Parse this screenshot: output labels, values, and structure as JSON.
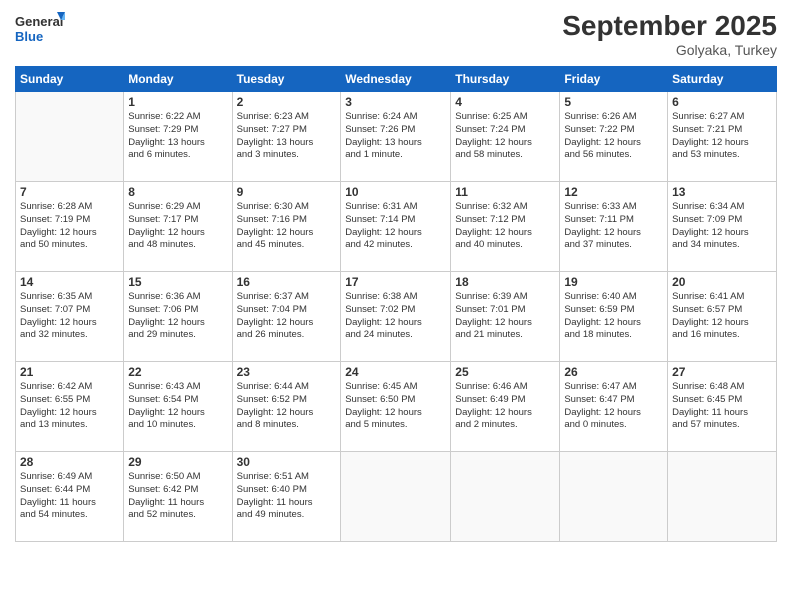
{
  "logo": {
    "line1": "General",
    "line2": "Blue"
  },
  "title": "September 2025",
  "location": "Golyaka, Turkey",
  "days_header": [
    "Sunday",
    "Monday",
    "Tuesday",
    "Wednesday",
    "Thursday",
    "Friday",
    "Saturday"
  ],
  "weeks": [
    [
      {
        "day": "",
        "info": ""
      },
      {
        "day": "1",
        "info": "Sunrise: 6:22 AM\nSunset: 7:29 PM\nDaylight: 13 hours\nand 6 minutes."
      },
      {
        "day": "2",
        "info": "Sunrise: 6:23 AM\nSunset: 7:27 PM\nDaylight: 13 hours\nand 3 minutes."
      },
      {
        "day": "3",
        "info": "Sunrise: 6:24 AM\nSunset: 7:26 PM\nDaylight: 13 hours\nand 1 minute."
      },
      {
        "day": "4",
        "info": "Sunrise: 6:25 AM\nSunset: 7:24 PM\nDaylight: 12 hours\nand 58 minutes."
      },
      {
        "day": "5",
        "info": "Sunrise: 6:26 AM\nSunset: 7:22 PM\nDaylight: 12 hours\nand 56 minutes."
      },
      {
        "day": "6",
        "info": "Sunrise: 6:27 AM\nSunset: 7:21 PM\nDaylight: 12 hours\nand 53 minutes."
      }
    ],
    [
      {
        "day": "7",
        "info": "Sunrise: 6:28 AM\nSunset: 7:19 PM\nDaylight: 12 hours\nand 50 minutes."
      },
      {
        "day": "8",
        "info": "Sunrise: 6:29 AM\nSunset: 7:17 PM\nDaylight: 12 hours\nand 48 minutes."
      },
      {
        "day": "9",
        "info": "Sunrise: 6:30 AM\nSunset: 7:16 PM\nDaylight: 12 hours\nand 45 minutes."
      },
      {
        "day": "10",
        "info": "Sunrise: 6:31 AM\nSunset: 7:14 PM\nDaylight: 12 hours\nand 42 minutes."
      },
      {
        "day": "11",
        "info": "Sunrise: 6:32 AM\nSunset: 7:12 PM\nDaylight: 12 hours\nand 40 minutes."
      },
      {
        "day": "12",
        "info": "Sunrise: 6:33 AM\nSunset: 7:11 PM\nDaylight: 12 hours\nand 37 minutes."
      },
      {
        "day": "13",
        "info": "Sunrise: 6:34 AM\nSunset: 7:09 PM\nDaylight: 12 hours\nand 34 minutes."
      }
    ],
    [
      {
        "day": "14",
        "info": "Sunrise: 6:35 AM\nSunset: 7:07 PM\nDaylight: 12 hours\nand 32 minutes."
      },
      {
        "day": "15",
        "info": "Sunrise: 6:36 AM\nSunset: 7:06 PM\nDaylight: 12 hours\nand 29 minutes."
      },
      {
        "day": "16",
        "info": "Sunrise: 6:37 AM\nSunset: 7:04 PM\nDaylight: 12 hours\nand 26 minutes."
      },
      {
        "day": "17",
        "info": "Sunrise: 6:38 AM\nSunset: 7:02 PM\nDaylight: 12 hours\nand 24 minutes."
      },
      {
        "day": "18",
        "info": "Sunrise: 6:39 AM\nSunset: 7:01 PM\nDaylight: 12 hours\nand 21 minutes."
      },
      {
        "day": "19",
        "info": "Sunrise: 6:40 AM\nSunset: 6:59 PM\nDaylight: 12 hours\nand 18 minutes."
      },
      {
        "day": "20",
        "info": "Sunrise: 6:41 AM\nSunset: 6:57 PM\nDaylight: 12 hours\nand 16 minutes."
      }
    ],
    [
      {
        "day": "21",
        "info": "Sunrise: 6:42 AM\nSunset: 6:55 PM\nDaylight: 12 hours\nand 13 minutes."
      },
      {
        "day": "22",
        "info": "Sunrise: 6:43 AM\nSunset: 6:54 PM\nDaylight: 12 hours\nand 10 minutes."
      },
      {
        "day": "23",
        "info": "Sunrise: 6:44 AM\nSunset: 6:52 PM\nDaylight: 12 hours\nand 8 minutes."
      },
      {
        "day": "24",
        "info": "Sunrise: 6:45 AM\nSunset: 6:50 PM\nDaylight: 12 hours\nand 5 minutes."
      },
      {
        "day": "25",
        "info": "Sunrise: 6:46 AM\nSunset: 6:49 PM\nDaylight: 12 hours\nand 2 minutes."
      },
      {
        "day": "26",
        "info": "Sunrise: 6:47 AM\nSunset: 6:47 PM\nDaylight: 12 hours\nand 0 minutes."
      },
      {
        "day": "27",
        "info": "Sunrise: 6:48 AM\nSunset: 6:45 PM\nDaylight: 11 hours\nand 57 minutes."
      }
    ],
    [
      {
        "day": "28",
        "info": "Sunrise: 6:49 AM\nSunset: 6:44 PM\nDaylight: 11 hours\nand 54 minutes."
      },
      {
        "day": "29",
        "info": "Sunrise: 6:50 AM\nSunset: 6:42 PM\nDaylight: 11 hours\nand 52 minutes."
      },
      {
        "day": "30",
        "info": "Sunrise: 6:51 AM\nSunset: 6:40 PM\nDaylight: 11 hours\nand 49 minutes."
      },
      {
        "day": "",
        "info": ""
      },
      {
        "day": "",
        "info": ""
      },
      {
        "day": "",
        "info": ""
      },
      {
        "day": "",
        "info": ""
      }
    ]
  ]
}
